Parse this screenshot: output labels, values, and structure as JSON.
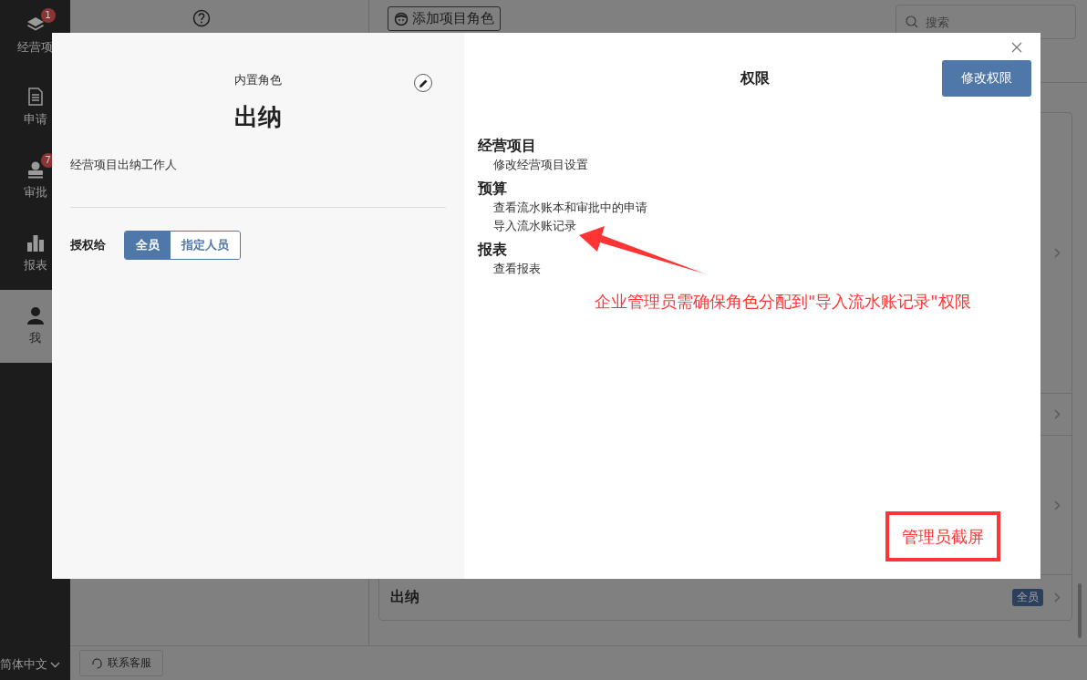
{
  "sidebar": {
    "items": [
      {
        "label": "经营项",
        "badge": "1",
        "selected": false
      },
      {
        "label": "申请",
        "selected": false
      },
      {
        "label": "审批",
        "badge": "7",
        "selected": false
      },
      {
        "label": "报表",
        "selected": false
      },
      {
        "label": "我",
        "selected": true
      }
    ],
    "language": "简体中文"
  },
  "header": {
    "add_role_button": "添加项目角色",
    "search": {
      "placeholder": "搜索"
    }
  },
  "role_list": [
    {
      "name": "出纳",
      "badge": "全员"
    }
  ],
  "footer": {
    "support_button": "联系客服"
  },
  "dialog": {
    "role_type": "内置角色",
    "role_name": "出纳",
    "description": "经营项目出纳工作人",
    "grant_label": "授权给",
    "grant_options": [
      {
        "label": "全员",
        "selected": true
      },
      {
        "label": "指定人员",
        "selected": false
      }
    ],
    "permissions_title": "权限",
    "edit_button": "修改权限",
    "permission_groups": [
      {
        "name": "经营项目",
        "items": [
          "修改经营项目设置"
        ]
      },
      {
        "name": "预算",
        "items": [
          "查看流水账本和审批中的申请",
          "导入流水账记录"
        ]
      },
      {
        "name": "报表",
        "items": [
          "查看报表"
        ]
      }
    ]
  },
  "annotations": {
    "note": "企业管理员需确保角色分配到\"导入流水账记录\"权限",
    "stamp": "管理员截屏"
  }
}
